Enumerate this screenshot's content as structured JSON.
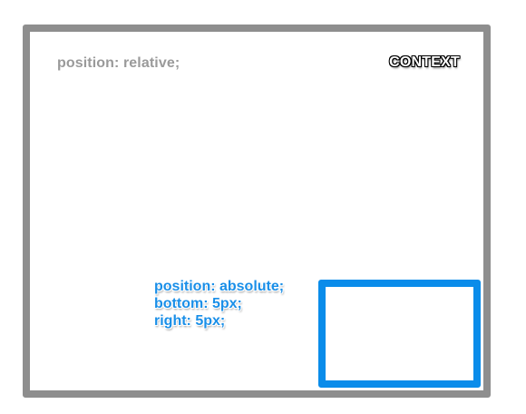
{
  "relative_container": {
    "label": "position: relative;",
    "context_label": "CONTEXT"
  },
  "absolute_child": {
    "lines": [
      "position: absolute;",
      "bottom: 5px;",
      "right: 5px;"
    ]
  },
  "colors": {
    "container_border": "#8e8e8e",
    "container_label": "#9a9a9a",
    "absolute_border": "#0a8cea",
    "absolute_label": "#1a8fe8",
    "background": "#ffffff"
  }
}
